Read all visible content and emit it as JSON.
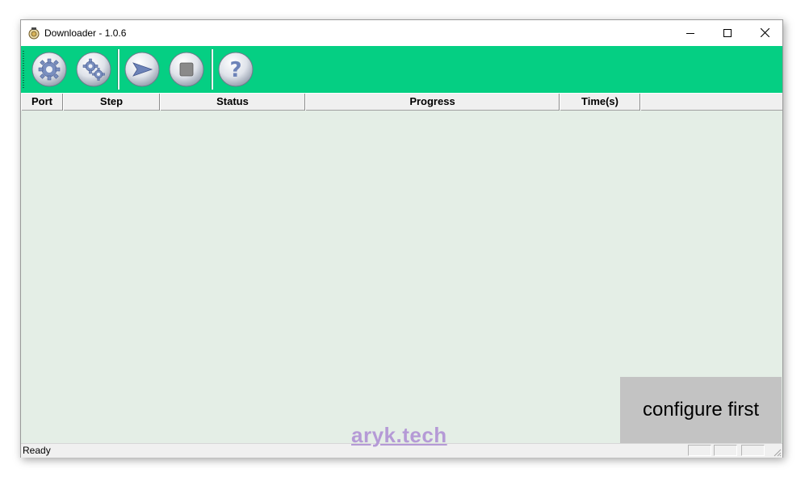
{
  "window": {
    "title": "Downloader - 1.0.6"
  },
  "toolbar": {
    "buttons": [
      {
        "name": "settings-icon"
      },
      {
        "name": "advanced-settings-icon"
      },
      {
        "name": "start-icon"
      },
      {
        "name": "stop-icon"
      },
      {
        "name": "help-icon"
      }
    ],
    "accent": "#05cf83"
  },
  "table": {
    "columns": [
      "Port",
      "Step",
      "Status",
      "Progress",
      "Time(s)",
      ""
    ]
  },
  "overlay": {
    "message": "configure first"
  },
  "statusbar": {
    "text": "Ready"
  },
  "watermark": {
    "text": "aryk.tech"
  }
}
